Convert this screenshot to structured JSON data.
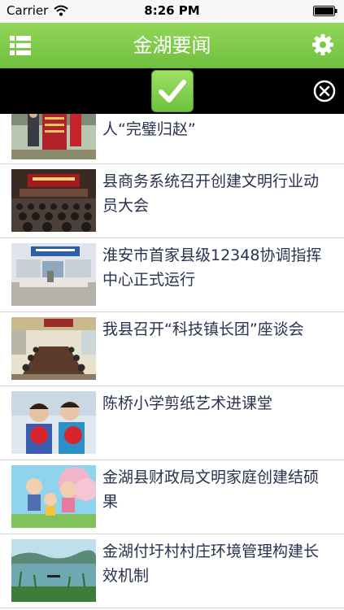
{
  "status_bar": {
    "carrier": "Carrier",
    "time": "8:26 PM",
    "wifi_icon": "wifi-icon",
    "battery_icon": "battery-icon"
  },
  "nav": {
    "title": "金湖要闻",
    "left_icon": "list-menu-icon",
    "right_icon": "gear-icon",
    "color": "#7cc94a"
  },
  "notice": {
    "icon": "checkmark-icon",
    "close_icon": "close-circle-icon"
  },
  "news": [
    {
      "title": "人“完璧归赵”",
      "thumb": "photo-banner-award"
    },
    {
      "title": "县商务系统召开创建文明行业动员大会",
      "thumb": "photo-conference-hall"
    },
    {
      "title": "淮安市首家县级12348协调指挥中心正式运行",
      "thumb": "photo-office-center"
    },
    {
      "title": "我县召开“科技镇长团”座谈会",
      "thumb": "photo-meeting-room"
    },
    {
      "title": "陈桥小学剪纸艺术进课堂",
      "thumb": "photo-children-papercut"
    },
    {
      "title": "金湖县财政局文明家庭创建结硕果",
      "thumb": "photo-cartoon-family"
    },
    {
      "title": "金湖付圩村村庄环境管理构建长效机制",
      "thumb": "photo-lake-village"
    }
  ]
}
